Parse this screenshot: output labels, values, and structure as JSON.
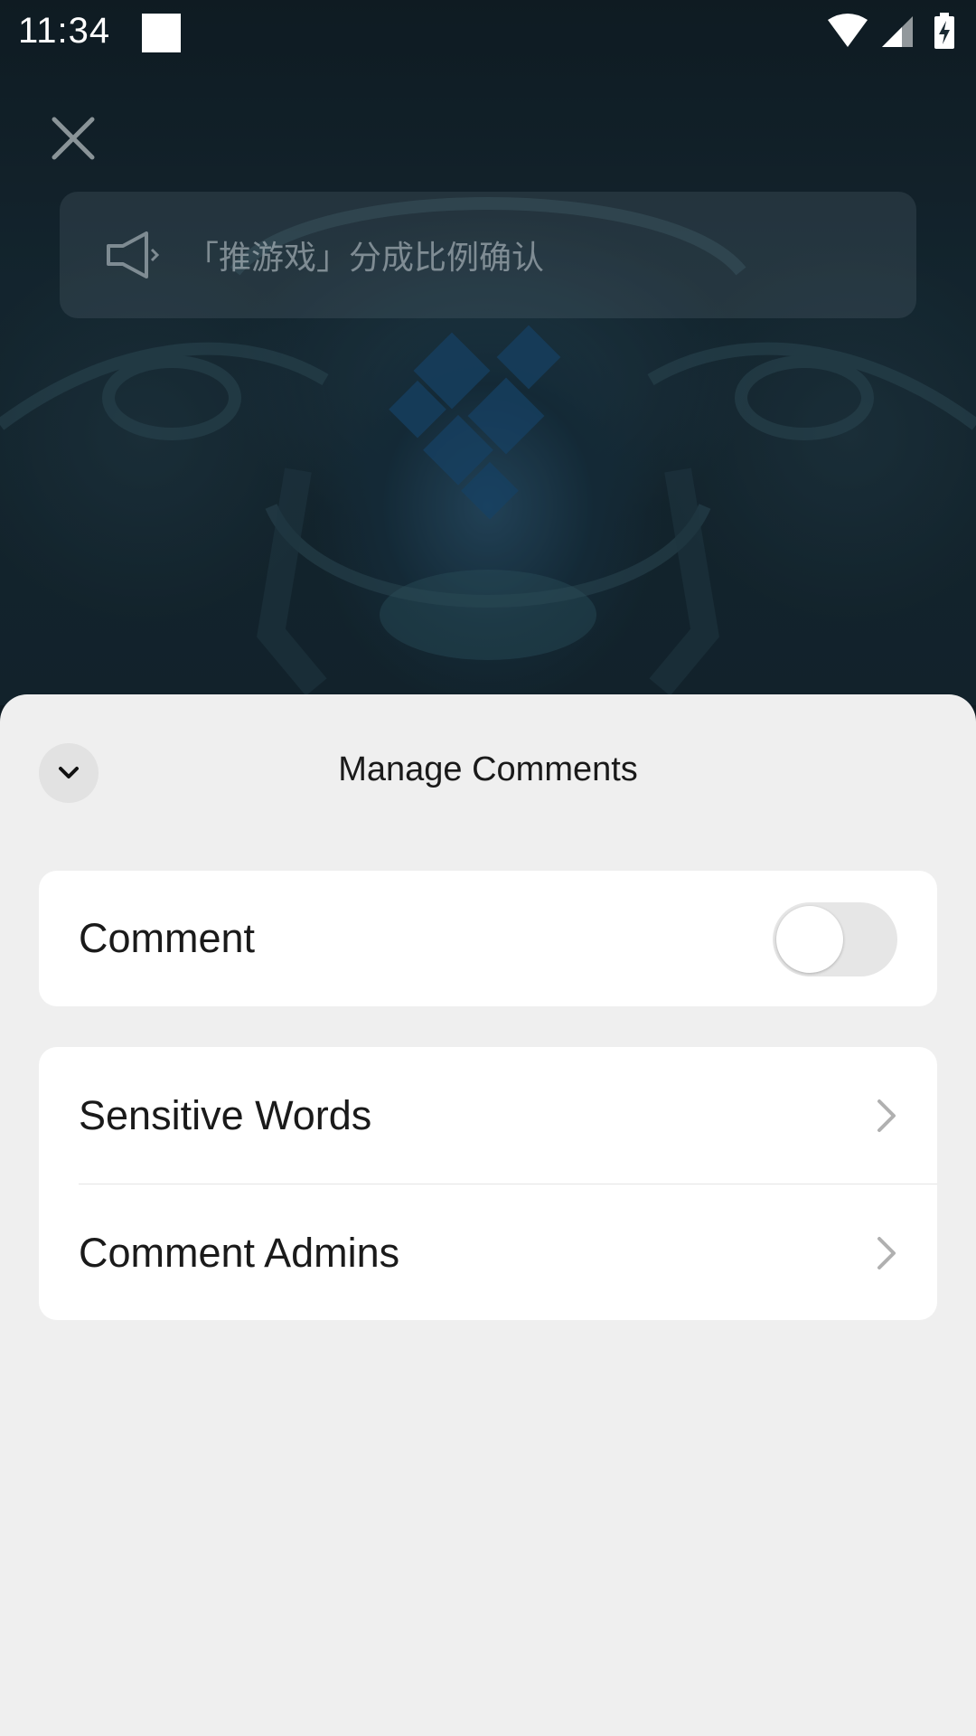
{
  "status_bar": {
    "time": "11:34"
  },
  "overlay": {
    "close_icon": "close-icon",
    "notice_icon": "megaphone-icon",
    "notice_text": "「推游戏」分成比例确认"
  },
  "sheet": {
    "title": "Manage Comments",
    "collapse_icon": "chevron-down-icon",
    "comment_toggle": {
      "label": "Comment",
      "enabled": false
    },
    "items": [
      {
        "label": "Sensitive Words",
        "icon": "chevron-right-icon"
      },
      {
        "label": "Comment Admins",
        "icon": "chevron-right-icon"
      }
    ]
  }
}
